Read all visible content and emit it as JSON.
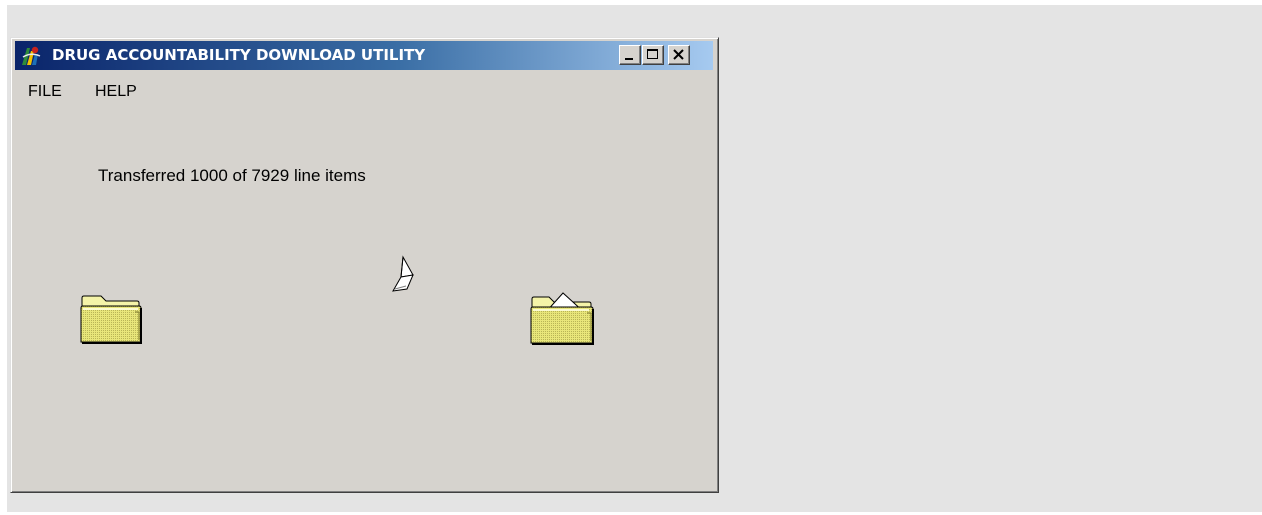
{
  "window": {
    "title": "DRUG ACCOUNTABILITY DOWNLOAD UTILITY",
    "app_icon": "app-logo-icon",
    "caption_buttons": [
      "minimize-icon",
      "maximize-icon",
      "close-icon"
    ]
  },
  "menu": {
    "items": [
      {
        "label": "FILE"
      },
      {
        "label": "HELP"
      }
    ]
  },
  "transfer": {
    "status_text": "Transferred 1000 of 7929 line items",
    "transferred": 1000,
    "total": 7929,
    "source_icon": "folder-closed-icon",
    "destination_icon": "folder-open-document-icon",
    "animation_icon": "flying-paper-icon"
  },
  "colors": {
    "titlebar_start": "#0a246a",
    "titlebar_end": "#a6caf0",
    "window_face": "#d6d3ce",
    "folder_yellow": "#e8e67a"
  }
}
